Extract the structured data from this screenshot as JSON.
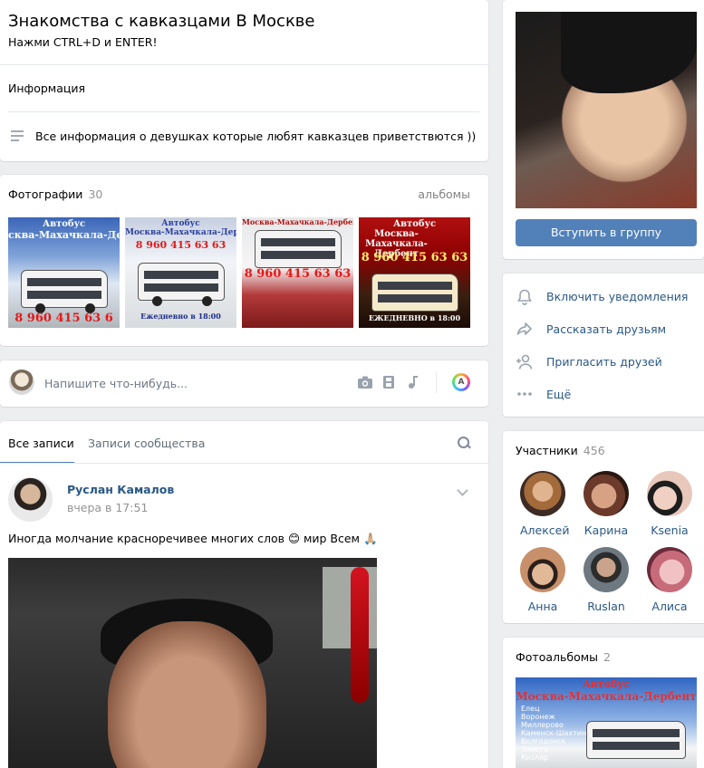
{
  "group": {
    "title": "Знакомства с кавказцами В Москве",
    "status": "Нажми CTRL+D и ENTER!",
    "info_label": "Информация",
    "description": "Все информация о девушках которые любят кавказцев приветствются ))"
  },
  "photos": {
    "title": "Фотографии",
    "count": "30",
    "link": "альбомы",
    "thumbs": [
      {
        "lines": [
          "Автобус",
          "сква-Махачкала-Дербе",
          "8 960 415 63 6"
        ]
      },
      {
        "lines": [
          "Автобус",
          "Москва-Махачкала-Дербент",
          "8 960 415 63 63",
          "Ежедневно в 18:00"
        ]
      },
      {
        "lines": [
          "Москва-Махачкала-Дербент",
          "8 960 415 63 63"
        ]
      },
      {
        "lines": [
          "Автобус",
          "Москва-",
          "Махачкала-",
          "Дербент",
          "8 960 415 63 63",
          "ЕЖЕДНЕВНО в 18:00"
        ]
      }
    ]
  },
  "postbox": {
    "placeholder": "Напишите что-нибудь...",
    "icons": [
      "camera-icon",
      "video-icon",
      "music-icon",
      "art-icon"
    ],
    "art_letter": "A"
  },
  "wall": {
    "tabs": [
      "Все записи",
      "Записи сообщества"
    ],
    "post": {
      "author": "Руслан Камалов",
      "time": "вчера в 17:51",
      "text": "Иногда молчание красноречивее многих слов 😊 мир Всем 🙏🏼"
    }
  },
  "sidebar": {
    "join_button": "Вступить в группу",
    "actions": [
      {
        "icon": "bell-icon",
        "label": "Включить уведомления"
      },
      {
        "icon": "share-icon",
        "label": "Рассказать друзьям"
      },
      {
        "icon": "add-friend-icon",
        "label": "Пригласить друзей"
      },
      {
        "icon": "more-icon",
        "label": "Ещё"
      }
    ],
    "members": {
      "title": "Участники",
      "count": "456",
      "people": [
        {
          "name": "Алексей",
          "color": "#b98a5e"
        },
        {
          "name": "Карина",
          "color": "#c79882"
        },
        {
          "name": "Ksenia",
          "color": "#d7b2a6"
        },
        {
          "name": "Анна",
          "color": "#caa182"
        },
        {
          "name": "Ruslan",
          "color": "#6b6f73"
        },
        {
          "name": "Алиса",
          "color": "#d6a0a6"
        }
      ]
    },
    "albums": {
      "title": "Фотоальбомы",
      "count": "2",
      "cover_lines": [
        "Автобус",
        "Москва-Махачкала-Дербент",
        "Елец",
        "Воронеж",
        "Миллерово",
        "Каменск-Шахтинский",
        "Волгодонск",
        "Элиста",
        "Кизляр"
      ]
    }
  },
  "colors": {
    "accent": "#5181b8",
    "link": "#2a5885",
    "bg": "#edeef0"
  }
}
